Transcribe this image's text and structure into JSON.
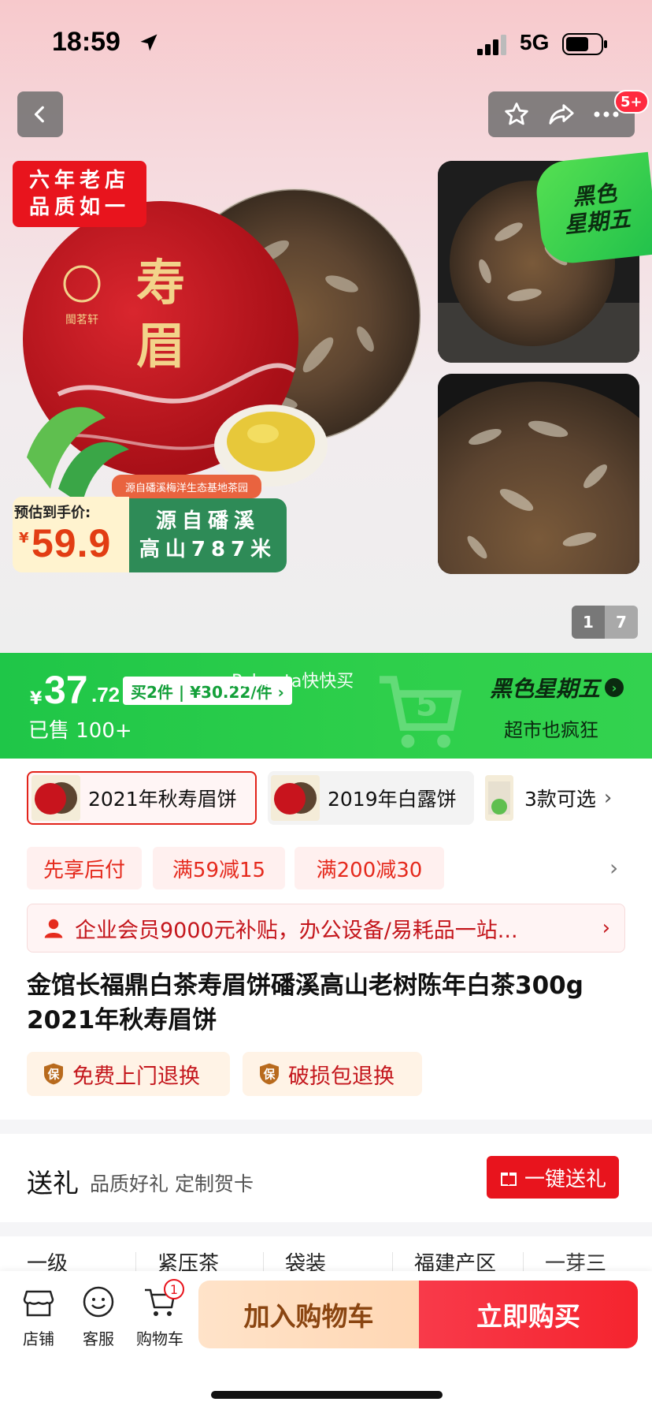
{
  "status_bar": {
    "time": "18:59",
    "network": "5G"
  },
  "nav": {
    "badge": "5+"
  },
  "hero": {
    "ribbon_line1": "六年老店",
    "ribbon_line2": "品质如一",
    "product_name_art": "寿眉",
    "brand_art": "閩茗轩",
    "origin_tag": "源自磻溪梅洋生态基地茶园",
    "estimate_label": "预估到手价:",
    "estimate_currency": "¥",
    "estimate_price": "59.9",
    "source_line1": "源自磻溪",
    "source_line2": "高山787米",
    "event_line1": "黑色",
    "event_line2": "星期五",
    "pager_current": "1",
    "pager_total": "7"
  },
  "price_bar": {
    "currency": "¥",
    "price_int": "37",
    "price_dec": ".72",
    "bundle": "买2件 | ¥30.22/件 ›",
    "brand_overlay": "Pabenta快快买",
    "sold": "已售 100+",
    "event": "黑色星期五",
    "event_sub": "超市也疯狂",
    "accent": "#21c14b"
  },
  "variants": [
    {
      "label": "2021年秋寿眉饼",
      "selected": true
    },
    {
      "label": "2019年白露饼",
      "selected": false
    },
    {
      "label": "3款可选",
      "selected": false
    }
  ],
  "promos": [
    "先享后付",
    "满59减15",
    "满200减30"
  ],
  "member": {
    "text": "企业会员9000元补贴，办公设备/易耗品一站..."
  },
  "title": "金馆长福鼎白茶寿眉饼磻溪高山老树陈年白茶300g 2021年秋寿眉饼",
  "services": [
    "免费上门退换",
    "破损包退换"
  ],
  "gift": {
    "title": "送礼",
    "sub": "品质好礼 定制贺卡",
    "button": "一键送礼"
  },
  "attributes": [
    "一级",
    "紧压茶",
    "袋装",
    "福建产区",
    "一芽三"
  ],
  "bottom": {
    "shop": "店铺",
    "service": "客服",
    "cart": "购物车",
    "cart_count": "1",
    "add_to_cart": "加入购物车",
    "buy_now": "立即购买"
  },
  "colors": {
    "brand_red": "#e8141d",
    "green": "#2ecf4b"
  }
}
